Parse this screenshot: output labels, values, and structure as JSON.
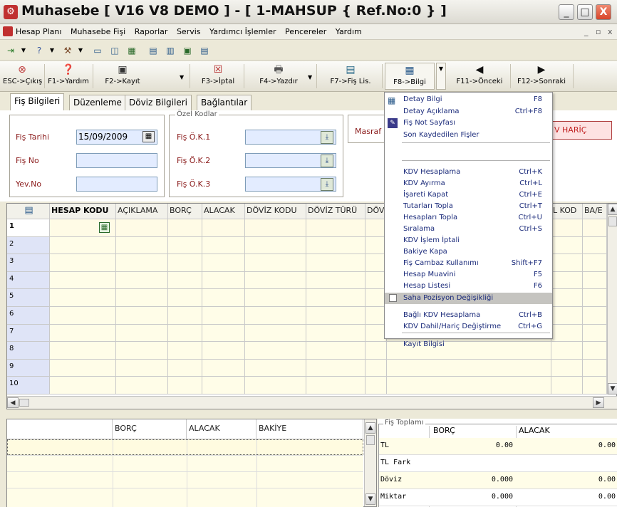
{
  "window": {
    "title": "Muhasebe [ V16 V8 DEMO ]  - [ 1-MAHSUP { Ref.No:0 } ]",
    "minimize": "_",
    "maximize": "□",
    "close": "X",
    "mdi_min": "_",
    "mdi_restore": "▫",
    "mdi_close": "x"
  },
  "menubar": {
    "items": [
      {
        "label": "Hesap Planı",
        "icon": "hesap-plani-icon"
      },
      {
        "label": "Muhasebe Fişi"
      },
      {
        "label": "Raporlar"
      },
      {
        "label": "Servis"
      },
      {
        "label": "Yardımcı İşlemler"
      },
      {
        "label": "Pencereler"
      },
      {
        "label": "Yardım"
      }
    ]
  },
  "toolbar": {
    "buttons": [
      {
        "label": "ESC->Çıkış",
        "icon": "exit-icon",
        "glyph": "⊗"
      },
      {
        "label": "F1->Yardım",
        "icon": "help-icon",
        "glyph": "❓"
      },
      {
        "label": "F2->Kayıt",
        "icon": "save-icon",
        "glyph": "▣"
      },
      {
        "label": "F3->İptal",
        "icon": "cancel-icon",
        "glyph": "☒"
      },
      {
        "label": "F4->Yazdır",
        "icon": "print-icon",
        "glyph": "🖶"
      },
      {
        "label": "F7->Fiş Lis.",
        "icon": "list-icon",
        "glyph": "▤"
      },
      {
        "label": "F8->Bilgi",
        "icon": "info-icon",
        "glyph": "▦"
      },
      {
        "label": "F11->Önceki",
        "icon": "arrow-left-icon",
        "glyph": "◀"
      },
      {
        "label": "F12->Sonraki",
        "icon": "arrow-right-icon",
        "glyph": "▶"
      }
    ]
  },
  "tabs": [
    "Fiş Bilgileri",
    "Düzenleme",
    "Döviz Bilgileri",
    "Bağlantılar"
  ],
  "form": {
    "fis_tarihi_label": "Fiş Tarihi",
    "fis_tarihi_value": "15/09/2009",
    "fis_no_label": "Fiş No",
    "fis_no_value": "",
    "yev_no_label": "Yev.No",
    "yev_no_value": "",
    "ozel_kodlar_title": "Özel Kodlar",
    "ok1_label": "Fiş Ö.K.1",
    "ok2_label": "Fiş Ö.K.2",
    "ok3_label": "Fiş Ö.K.3",
    "masraf_label": "Masraf",
    "kdv_button": "V HARİÇ"
  },
  "grid": {
    "columns": [
      "HESAP KODU",
      "AÇIKLAMA",
      "BORÇ",
      "ALACAK",
      "DÖVİZ KODU",
      "DÖVİZ TÜRÜ",
      "DÖV",
      "L KOD",
      "BA/E"
    ],
    "rows": [
      "1",
      "2",
      "3",
      "4",
      "5",
      "6",
      "7",
      "8",
      "9",
      "10"
    ]
  },
  "bottom_left": {
    "columns": [
      "BORÇ",
      "ALACAK",
      "BAKİYE"
    ]
  },
  "bottom_right": {
    "title": "Fiş Toplamı",
    "columns": [
      "BORÇ",
      "ALACAK"
    ],
    "rows": [
      {
        "label": "TL",
        "borc": "0.00",
        "alacak": "0.00"
      },
      {
        "label": "TL Fark",
        "borc": "",
        "alacak": ""
      },
      {
        "label": "Döviz",
        "borc": "0.000",
        "alacak": "0.00"
      },
      {
        "label": "Miktar",
        "borc": "0.000",
        "alacak": "0.00"
      }
    ]
  },
  "dropdown": {
    "items": [
      {
        "label": "Detay Bilgi",
        "shortcut": "F8",
        "icon": "detay-bilgi-icon"
      },
      {
        "label": "Detay Açıklama",
        "shortcut": "Ctrl+F8"
      },
      {
        "label": "Fiş Not Sayfası",
        "shortcut": "",
        "icon": "not-sayfasi-icon"
      },
      {
        "label": "Son Kaydedilen Fişler",
        "shortcut": ""
      },
      {
        "label": "KDV Hesaplama",
        "shortcut": "Ctrl+K"
      },
      {
        "label": "KDV Ayırma",
        "shortcut": "Ctrl+L"
      },
      {
        "label": "İşareti Kapat",
        "shortcut": "Ctrl+E"
      },
      {
        "label": "Tutarları Topla",
        "shortcut": "Ctrl+T"
      },
      {
        "label": "Hesapları Topla",
        "shortcut": "Ctrl+U"
      },
      {
        "label": "Sıralama",
        "shortcut": "Ctrl+S"
      },
      {
        "label": "KDV İşlem İptali",
        "shortcut": ""
      },
      {
        "label": "Bakiye Kapa",
        "shortcut": ""
      },
      {
        "label": "Fiş Cambaz Kullanımı",
        "shortcut": "Shift+F7"
      },
      {
        "label": "Hesap Muavini",
        "shortcut": "F5"
      },
      {
        "label": "Hesap Listesi",
        "shortcut": "F6"
      },
      {
        "label": "Saha Pozisyon Değişikliği",
        "shortcut": ""
      },
      {
        "label": "Bağlı KDV Hesaplama",
        "shortcut": "Ctrl+B"
      },
      {
        "label": "KDV Dahil/Hariç Değiştirme",
        "shortcut": "Ctrl+G"
      },
      {
        "label": "Kayıt Bilgisi",
        "shortcut": ""
      }
    ]
  }
}
